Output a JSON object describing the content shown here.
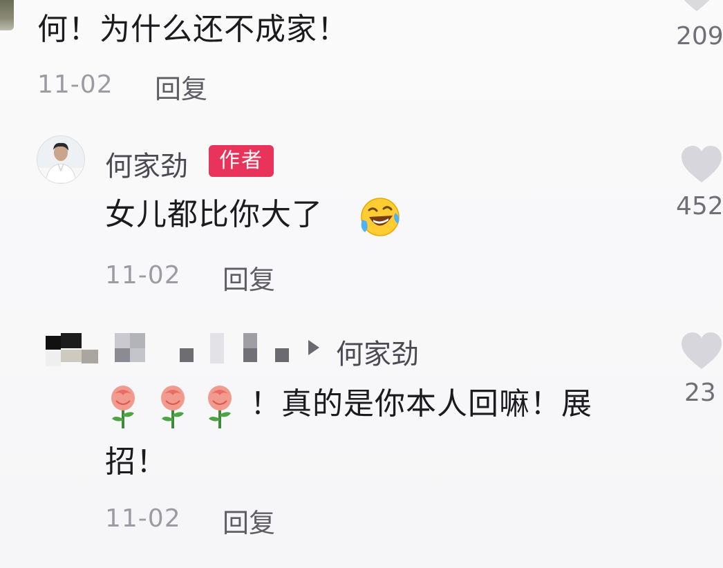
{
  "comments": {
    "top": {
      "text": "何！为什么还不成家！",
      "date": "11-02",
      "reply_label": "回复",
      "like_count": "209",
      "like_icon": "heart-icon"
    },
    "reply1": {
      "username": "何家劲",
      "badge": "作者",
      "text": "女儿都比你大了",
      "emoji": "laughing-crying-emoji",
      "date": "11-02",
      "reply_label": "回复",
      "like_count": "452",
      "like_icon": "heart-icon"
    },
    "reply2": {
      "reply_target": "何家劲",
      "text_after_roses": "！真的是你本人回嘛！展",
      "text_line2": "招！",
      "emoji": "rose-emoji",
      "date": "11-02",
      "reply_label": "回复",
      "like_count": "23",
      "like_icon": "heart-icon"
    }
  },
  "colors": {
    "author_badge": "#e8335a",
    "like_icon": "#d6d6dc"
  }
}
